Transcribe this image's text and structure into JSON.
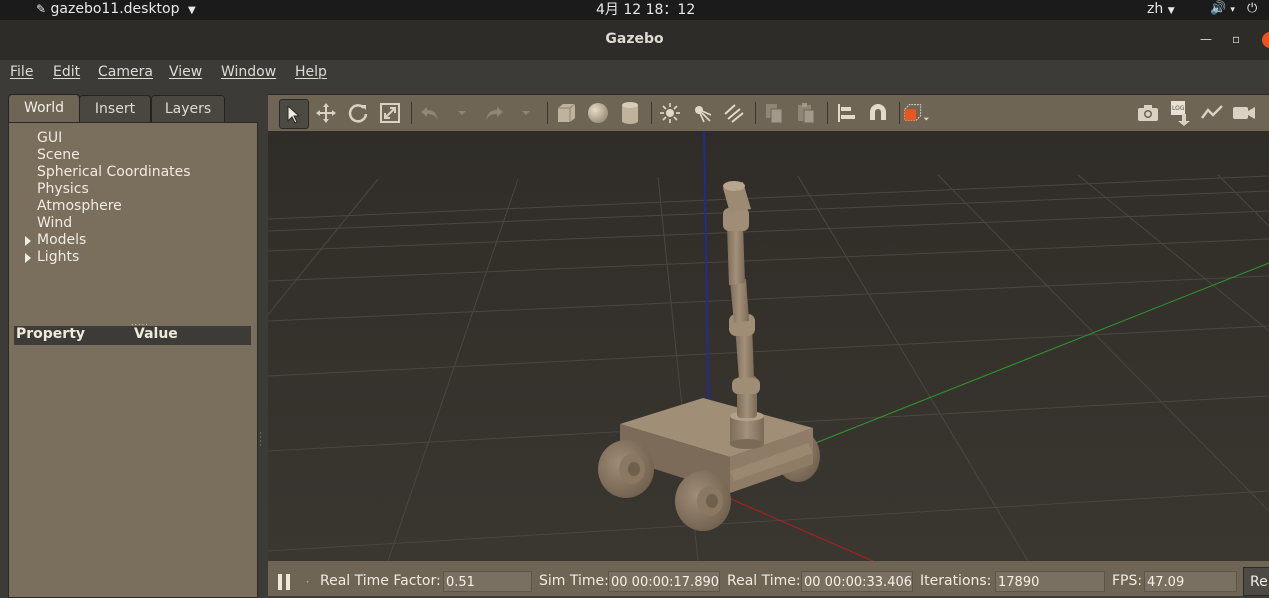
{
  "system_bar": {
    "app_name": "gazebo11.desktop",
    "clock": "4月 12  18：12",
    "language": "zh"
  },
  "window": {
    "title": "Gazebo"
  },
  "menu": {
    "items": [
      "File",
      "Edit",
      "Camera",
      "View",
      "Window",
      "Help"
    ]
  },
  "left_panel": {
    "tabs": [
      "World",
      "Insert",
      "Layers"
    ],
    "active_tab": "World",
    "tree": [
      {
        "label": "GUI",
        "expandable": false
      },
      {
        "label": "Scene",
        "expandable": false
      },
      {
        "label": "Spherical Coordinates",
        "expandable": false
      },
      {
        "label": "Physics",
        "expandable": false
      },
      {
        "label": "Atmosphere",
        "expandable": false
      },
      {
        "label": "Wind",
        "expandable": false
      },
      {
        "label": "Models",
        "expandable": true
      },
      {
        "label": "Lights",
        "expandable": true
      }
    ],
    "property_header": "Property",
    "value_header": "Value"
  },
  "toolbar": {
    "icons": [
      "select-arrow-icon",
      "translate-icon",
      "rotate-icon",
      "scale-icon",
      "undo-icon",
      "redo-icon",
      "box-shape-icon",
      "sphere-shape-icon",
      "cylinder-shape-icon",
      "point-light-icon",
      "spot-light-icon",
      "directional-light-icon",
      "copy-icon",
      "paste-icon",
      "align-icon",
      "snap-magnet-icon",
      "view-angle-icon",
      "screenshot-icon",
      "log-icon",
      "plot-icon",
      "video-record-icon"
    ],
    "accent_color": "#e95420"
  },
  "status_bar": {
    "real_time_factor_label": "Real Time Factor:",
    "real_time_factor": "0.51",
    "sim_time_label": "Sim Time:",
    "sim_time": "00 00:00:17.890",
    "real_time_label": "Real Time:",
    "real_time": "00 00:00:33.406",
    "iterations_label": "Iterations:",
    "iterations": "17890",
    "fps_label": "FPS:",
    "fps": "47.09",
    "reset_label": "Re"
  }
}
